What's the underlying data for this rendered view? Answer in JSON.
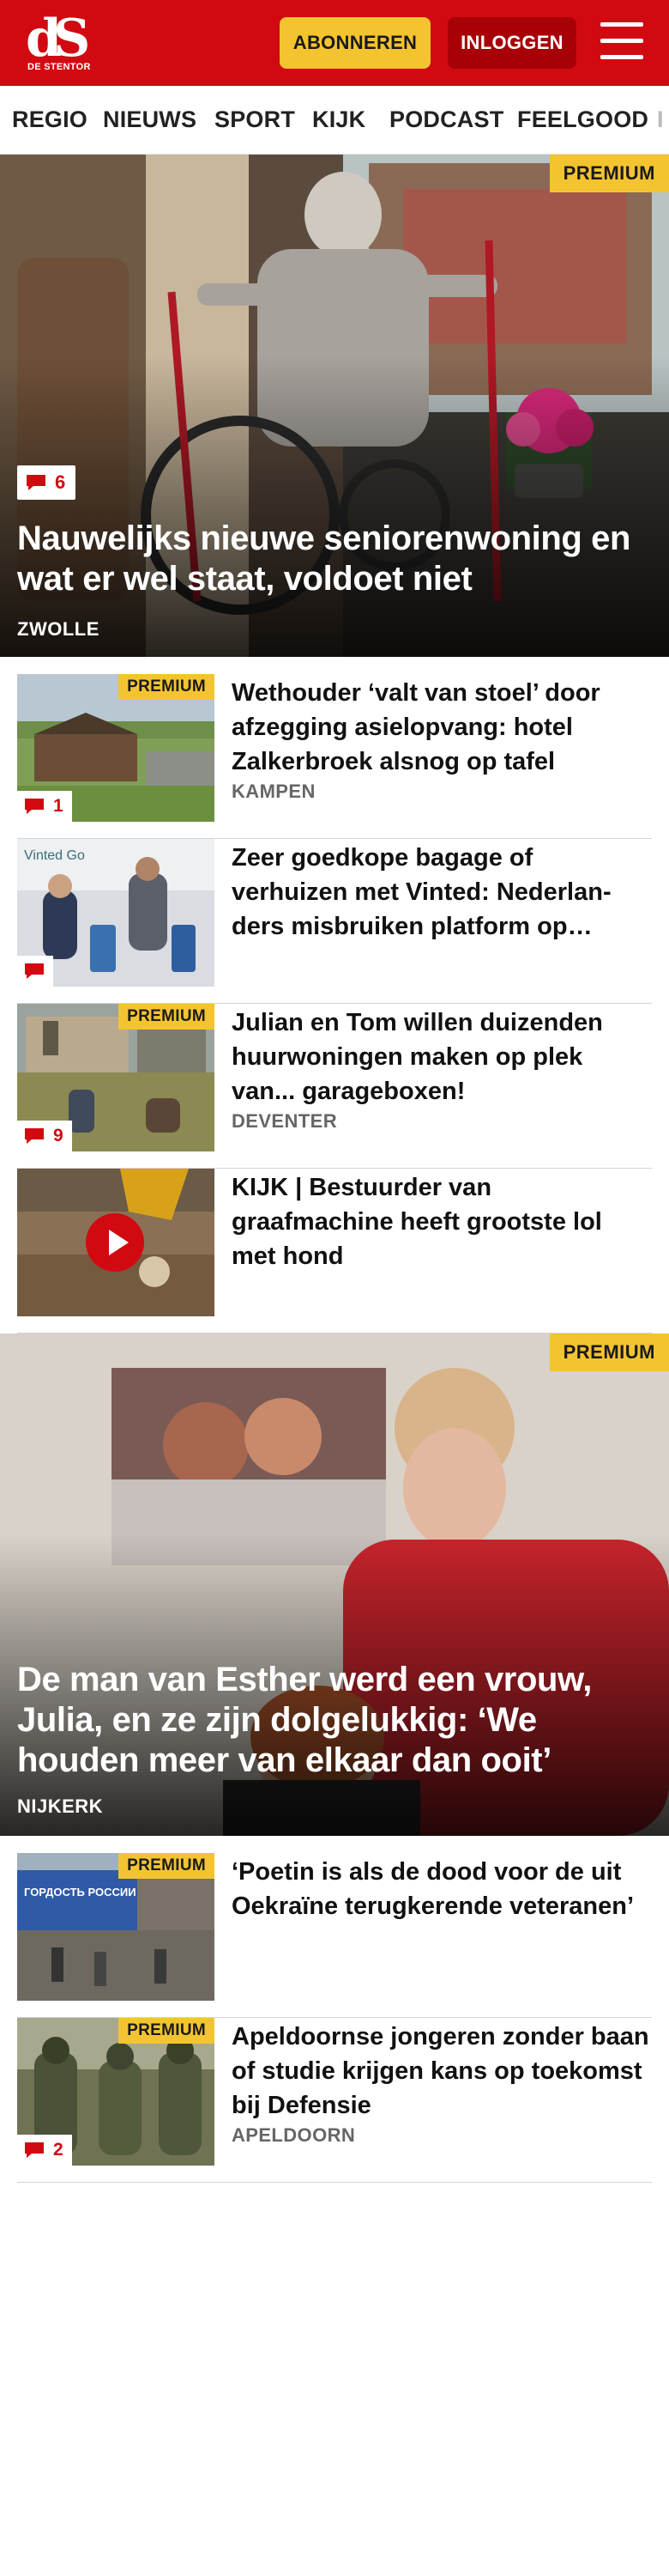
{
  "header": {
    "logo_mark": "dS",
    "logo_text": "DE STENTOR",
    "subscribe_label": "ABONNEREN",
    "login_label": "INLOGGEN",
    "menu_icon": "hamburger-icon",
    "brand_color": "#d10a11",
    "accent_color": "#f4c430"
  },
  "nav": {
    "items": [
      "REGIO",
      "NIEUWS",
      "SPORT",
      "KIJK",
      "PODCAST",
      "FEELGOOD",
      "I"
    ]
  },
  "articles": [
    {
      "badge": "PREMIUM",
      "comments": "6",
      "title": "Nauwelijks nieuwe seniorenwoning en wat er wel staat, voldoet niet",
      "location": "ZWOLLE"
    },
    {
      "badge": "PREMIUM",
      "comments": "1",
      "title": "Wethouder ‘valt van stoel’ door afzegging asielopvang: hotel Zalkerbroek alsnog op tafel",
      "location": "KAMPEN"
    },
    {
      "badge": "",
      "comments": "",
      "title": "Zeer goedkope bagage of verhuizen met Vinted: Nederlan­ders misbruiken platform op…",
      "location": "",
      "image_text": "Vinted Go"
    },
    {
      "badge": "PREMIUM",
      "comments": "9",
      "title": "Julian en Tom willen duizenden huurwoningen maken op plek van... garageboxen!",
      "location": "DEVENTER"
    },
    {
      "badge": "",
      "comments": "",
      "title": "KIJK | Bestuurder van graafmachine heeft grootste lol met hond",
      "location": "",
      "icon": "play-icon"
    },
    {
      "badge": "PREMIUM",
      "comments": "",
      "title": "De man van Esther werd een vrouw, Julia, en ze zijn dolgelukkig: ‘We houden meer van elkaar dan ooit’",
      "location": "NIJKERK"
    },
    {
      "badge": "PREMIUM",
      "comments": "",
      "title": "‘Poetin is als de dood voor de uit Oekraïne terugkerende veteranen’",
      "location": "",
      "image_text": "ГОРДОСТЬ РОССИИ"
    },
    {
      "badge": "PREMIUM",
      "comments": "2",
      "title": "Apeldoornse jongeren zonder baan of studie krijgen kans op toekomst bij Defensie",
      "location": "APELDOORN"
    }
  ]
}
